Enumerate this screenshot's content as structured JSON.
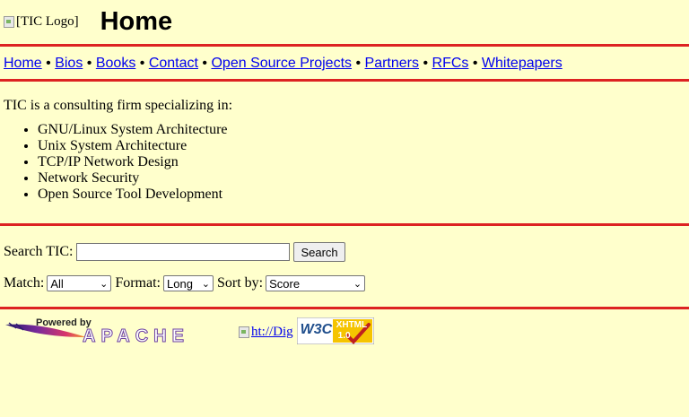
{
  "header": {
    "logo_alt": "[TIC Logo]",
    "title": "Home"
  },
  "nav": {
    "links": [
      "Home",
      "Bios",
      "Books",
      "Contact",
      "Open Source Projects",
      "Partners",
      "RFCs",
      "Whitepapers"
    ],
    "separator": "•"
  },
  "intro": "TIC is a consulting firm specializing in:",
  "specialties": [
    "GNU/Linux System Architecture",
    "Unix System Architecture",
    "TCP/IP Network Design",
    "Network Security",
    "Open Source Tool Development"
  ],
  "search": {
    "label": "Search TIC:",
    "value": "",
    "button_label": "Search"
  },
  "options": {
    "match_label": "Match:",
    "match_value": "All",
    "format_label": "Format:",
    "format_value": "Long",
    "sort_label": "Sort by:",
    "sort_value": "Score"
  },
  "badges": {
    "apache_powered": "Powered by",
    "apache_word": "APACHE",
    "htdig_alt": "ht://Dig",
    "w3c_text": "W3C",
    "xhtml_text": "XHTML",
    "xhtml_version": "1.0"
  },
  "colors": {
    "background": "#ffffcc",
    "rule": "#dd2222",
    "link": "#0000ee"
  }
}
